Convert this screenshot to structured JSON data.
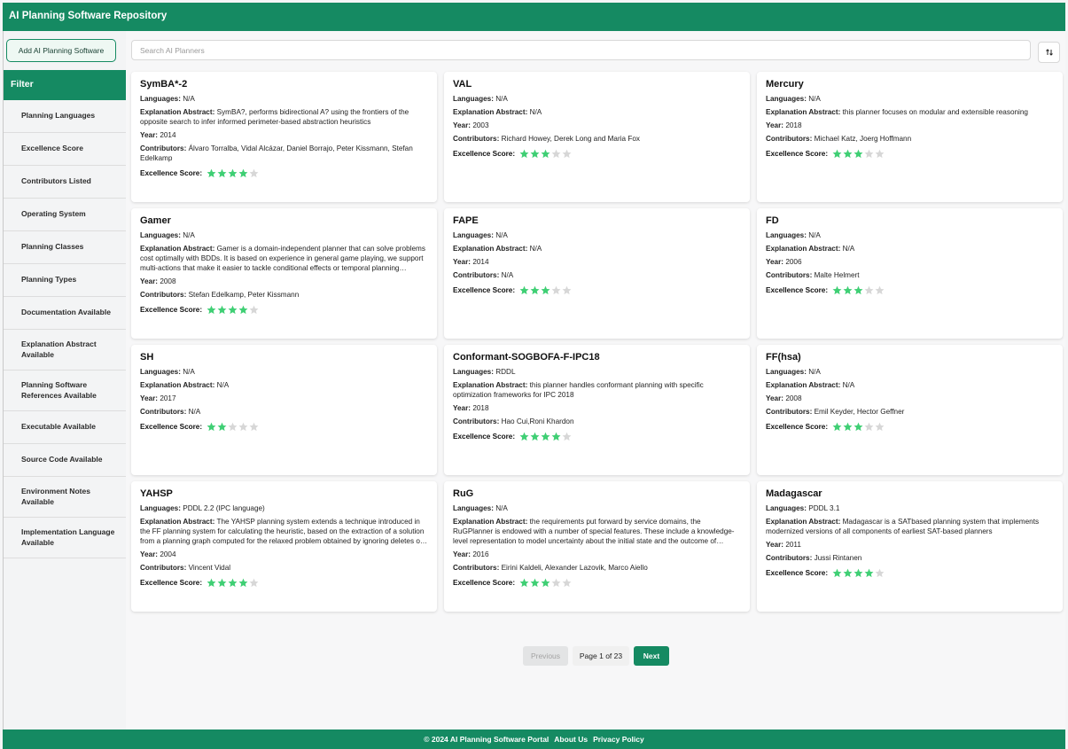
{
  "header": {
    "title": "AI Planning Software Repository"
  },
  "sidebar": {
    "add_button": "Add AI Planning Software",
    "filter_title": "Filter",
    "filters": [
      "Planning Languages",
      "Excellence Score",
      "Contributors Listed",
      "Operating System",
      "Planning Classes",
      "Planning Types",
      "Documentation Available",
      "Explanation Abstract Available",
      "Planning Software References Available",
      "Executable Available",
      "Source Code Available",
      "Environment Notes Available",
      "Implementation Language Available"
    ]
  },
  "search": {
    "placeholder": "Search AI Planners",
    "value": ""
  },
  "labels": {
    "languages": "Languages:",
    "abstract": "Explanation Abstract:",
    "year": "Year:",
    "contributors": "Contributors:",
    "score": "Excellence Score:"
  },
  "colors": {
    "brand": "#158a62",
    "star_on": "#3fcf74",
    "star_off": "#d7d7d7"
  },
  "cards": [
    {
      "title": "SymBA*-2",
      "languages": "N/A",
      "abstract": "SymBA?, performs bidirectional A? using the frontiers of the opposite search to infer informed perimeter-based abstraction heuristics",
      "year": "2014",
      "contributors": "Álvaro Torralba, Vidal Alcázar, Daniel Borrajo, Peter Kissmann, Stefan Edelkamp",
      "score": 4
    },
    {
      "title": "VAL",
      "languages": "N/A",
      "abstract": "N/A",
      "year": "2003",
      "contributors": "Richard Howey, Derek Long and Maria Fox",
      "score": 3
    },
    {
      "title": "Mercury",
      "languages": "N/A",
      "abstract": "this planner focuses on modular and extensible reasoning",
      "year": "2018",
      "contributors": "Michael Katz, Joerg Hoffmann",
      "score": 3
    },
    {
      "title": "Gamer",
      "languages": "N/A",
      "abstract": "Gamer is a domain-independent planner that can solve problems cost optimally with BDDs. It is based on experience in general game playing, we support multi-actions that make it easier to tackle conditional effects or temporal planning problems.",
      "year": "2008",
      "contributors": "Stefan Edelkamp, Peter Kissmann",
      "score": 4
    },
    {
      "title": "FAPE",
      "languages": "N/A",
      "abstract": "N/A",
      "year": "2014",
      "contributors": "N/A",
      "score": 3
    },
    {
      "title": "FD",
      "languages": "N/A",
      "abstract": "N/A",
      "year": "2006",
      "contributors": "Malte Helmert",
      "score": 3
    },
    {
      "title": "SH",
      "languages": "N/A",
      "abstract": "N/A",
      "year": "2017",
      "contributors": "N/A",
      "score": 2
    },
    {
      "title": "Conformant-SOGBOFA-F-IPC18",
      "languages": "RDDL",
      "abstract": "this planner handles conformant planning with specific optimization frameworks for IPC 2018",
      "year": "2018",
      "contributors": "Hao Cui,Roni Khardon",
      "score": 4
    },
    {
      "title": "FF(hsa)",
      "languages": "N/A",
      "abstract": "N/A",
      "year": "2008",
      "contributors": "Emil Keyder, Hector Geffner",
      "score": 3
    },
    {
      "title": "YAHSP",
      "languages": "PDDL 2.2 (IPC language)",
      "abstract": "The YAHSP planning system extends a technique introduced in the FF planning system for calculating the heuristic, based on the extraction of a solution from a planning graph computed for the relaxed problem obtained by ignoring deletes of actions.",
      "year": "2004",
      "contributors": "Vincent Vidal",
      "score": 4
    },
    {
      "title": "RuG",
      "languages": "N/A",
      "abstract": "the requirements put forward by service domains, the RuGPlanner is endowed with a number of special features. These include a knowledge-level representation to model uncertainty about the initial state and the outcome of actions.",
      "year": "2016",
      "contributors": "Eirini Kaldeli, Alexander Lazovik, Marco Aiello",
      "score": 3
    },
    {
      "title": "Madagascar",
      "languages": "PDDL 3.1",
      "abstract": "Madagascar is a SATbased planning system that implements modernized versions of all components of earliest SAT-based planners",
      "year": "2011",
      "contributors": "Jussi Rintanen",
      "score": 4
    }
  ],
  "pagination": {
    "previous": "Previous",
    "page_label": "Page 1 of 23",
    "next": "Next"
  },
  "footer": {
    "copyright": "© 2024 AI Planning Software Portal",
    "about": "About Us",
    "privacy": "Privacy Policy"
  }
}
